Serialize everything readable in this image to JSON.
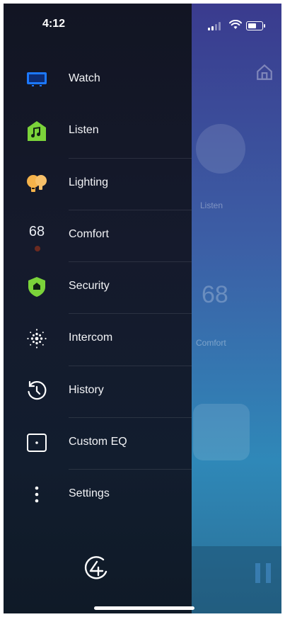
{
  "status_bar": {
    "time": "4:12"
  },
  "menu": {
    "items": [
      {
        "label": "Watch",
        "icon": "tv-icon"
      },
      {
        "label": "Listen",
        "icon": "music-house-icon"
      },
      {
        "label": "Lighting",
        "icon": "bulbs-icon"
      },
      {
        "label": "Comfort",
        "icon": "thermostat-icon",
        "value": "68"
      },
      {
        "label": "Security",
        "icon": "shield-icon"
      },
      {
        "label": "Intercom",
        "icon": "intercom-dots-icon"
      },
      {
        "label": "History",
        "icon": "history-clock-icon"
      },
      {
        "label": "Custom EQ",
        "icon": "speaker-box-icon"
      },
      {
        "label": "Settings",
        "icon": "more-vertical-icon"
      }
    ]
  },
  "background": {
    "tile_label_listen": "Listen",
    "tile_label_comfort": "Comfort",
    "temperature": "68"
  },
  "colors": {
    "green_accent": "#7bd33a",
    "watch_blue": "#1c78ff",
    "lighting_orange": "#f5b24a"
  }
}
